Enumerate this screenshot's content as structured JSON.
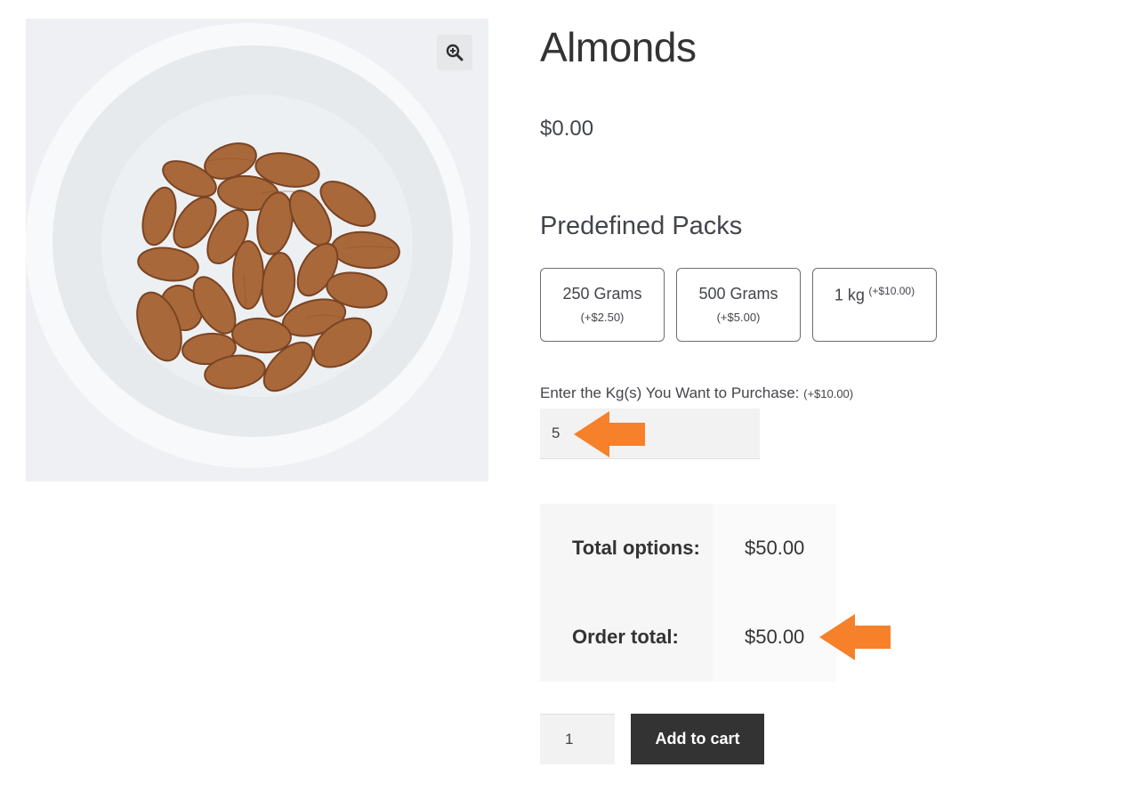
{
  "product": {
    "title": "Almonds",
    "price": "$0.00",
    "image_alt": "Bowl of almonds",
    "zoom_icon": "zoom-in-icon"
  },
  "packs": {
    "heading": "Predefined Packs",
    "items": [
      {
        "name": "250 Grams",
        "price": "(+$2.50)"
      },
      {
        "name": "500 Grams",
        "price": "(+$5.00)"
      },
      {
        "name": "1 kg",
        "price": "(+$10.00)"
      }
    ]
  },
  "kg_field": {
    "label": "Enter the Kg(s) You Want to Purchase:",
    "price_note": "(+$10.00)",
    "value": "5"
  },
  "totals": {
    "options_label": "Total options:",
    "options_value": "$50.00",
    "order_label": "Order total:",
    "order_value": "$50.00"
  },
  "cart": {
    "quantity": "1",
    "add_label": "Add to cart"
  },
  "colors": {
    "accent_arrow": "#f7802b",
    "button_bg": "#333333"
  }
}
